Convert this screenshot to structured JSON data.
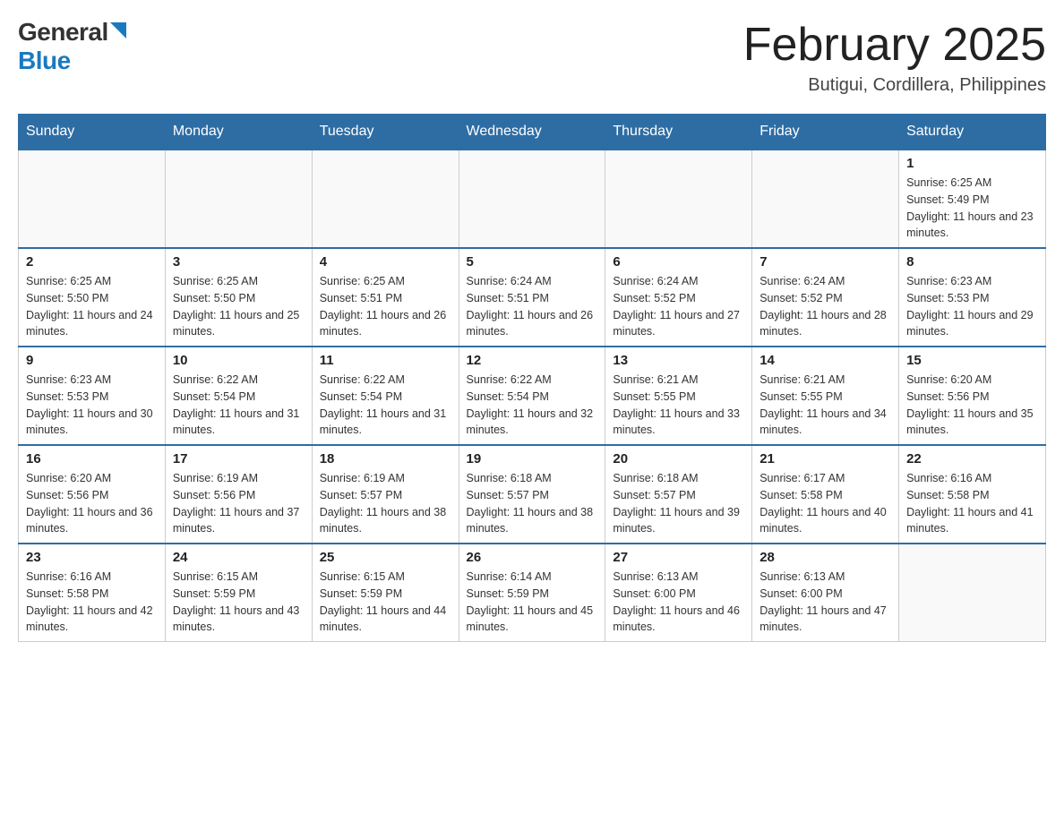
{
  "header": {
    "logo": {
      "general_text": "General",
      "blue_text": "Blue"
    },
    "title": "February 2025",
    "location": "Butigui, Cordillera, Philippines"
  },
  "calendar": {
    "days_of_week": [
      "Sunday",
      "Monday",
      "Tuesday",
      "Wednesday",
      "Thursday",
      "Friday",
      "Saturday"
    ],
    "weeks": [
      [
        {
          "day": "",
          "info": ""
        },
        {
          "day": "",
          "info": ""
        },
        {
          "day": "",
          "info": ""
        },
        {
          "day": "",
          "info": ""
        },
        {
          "day": "",
          "info": ""
        },
        {
          "day": "",
          "info": ""
        },
        {
          "day": "1",
          "info": "Sunrise: 6:25 AM\nSunset: 5:49 PM\nDaylight: 11 hours and 23 minutes."
        }
      ],
      [
        {
          "day": "2",
          "info": "Sunrise: 6:25 AM\nSunset: 5:50 PM\nDaylight: 11 hours and 24 minutes."
        },
        {
          "day": "3",
          "info": "Sunrise: 6:25 AM\nSunset: 5:50 PM\nDaylight: 11 hours and 25 minutes."
        },
        {
          "day": "4",
          "info": "Sunrise: 6:25 AM\nSunset: 5:51 PM\nDaylight: 11 hours and 26 minutes."
        },
        {
          "day": "5",
          "info": "Sunrise: 6:24 AM\nSunset: 5:51 PM\nDaylight: 11 hours and 26 minutes."
        },
        {
          "day": "6",
          "info": "Sunrise: 6:24 AM\nSunset: 5:52 PM\nDaylight: 11 hours and 27 minutes."
        },
        {
          "day": "7",
          "info": "Sunrise: 6:24 AM\nSunset: 5:52 PM\nDaylight: 11 hours and 28 minutes."
        },
        {
          "day": "8",
          "info": "Sunrise: 6:23 AM\nSunset: 5:53 PM\nDaylight: 11 hours and 29 minutes."
        }
      ],
      [
        {
          "day": "9",
          "info": "Sunrise: 6:23 AM\nSunset: 5:53 PM\nDaylight: 11 hours and 30 minutes."
        },
        {
          "day": "10",
          "info": "Sunrise: 6:22 AM\nSunset: 5:54 PM\nDaylight: 11 hours and 31 minutes."
        },
        {
          "day": "11",
          "info": "Sunrise: 6:22 AM\nSunset: 5:54 PM\nDaylight: 11 hours and 31 minutes."
        },
        {
          "day": "12",
          "info": "Sunrise: 6:22 AM\nSunset: 5:54 PM\nDaylight: 11 hours and 32 minutes."
        },
        {
          "day": "13",
          "info": "Sunrise: 6:21 AM\nSunset: 5:55 PM\nDaylight: 11 hours and 33 minutes."
        },
        {
          "day": "14",
          "info": "Sunrise: 6:21 AM\nSunset: 5:55 PM\nDaylight: 11 hours and 34 minutes."
        },
        {
          "day": "15",
          "info": "Sunrise: 6:20 AM\nSunset: 5:56 PM\nDaylight: 11 hours and 35 minutes."
        }
      ],
      [
        {
          "day": "16",
          "info": "Sunrise: 6:20 AM\nSunset: 5:56 PM\nDaylight: 11 hours and 36 minutes."
        },
        {
          "day": "17",
          "info": "Sunrise: 6:19 AM\nSunset: 5:56 PM\nDaylight: 11 hours and 37 minutes."
        },
        {
          "day": "18",
          "info": "Sunrise: 6:19 AM\nSunset: 5:57 PM\nDaylight: 11 hours and 38 minutes."
        },
        {
          "day": "19",
          "info": "Sunrise: 6:18 AM\nSunset: 5:57 PM\nDaylight: 11 hours and 38 minutes."
        },
        {
          "day": "20",
          "info": "Sunrise: 6:18 AM\nSunset: 5:57 PM\nDaylight: 11 hours and 39 minutes."
        },
        {
          "day": "21",
          "info": "Sunrise: 6:17 AM\nSunset: 5:58 PM\nDaylight: 11 hours and 40 minutes."
        },
        {
          "day": "22",
          "info": "Sunrise: 6:16 AM\nSunset: 5:58 PM\nDaylight: 11 hours and 41 minutes."
        }
      ],
      [
        {
          "day": "23",
          "info": "Sunrise: 6:16 AM\nSunset: 5:58 PM\nDaylight: 11 hours and 42 minutes."
        },
        {
          "day": "24",
          "info": "Sunrise: 6:15 AM\nSunset: 5:59 PM\nDaylight: 11 hours and 43 minutes."
        },
        {
          "day": "25",
          "info": "Sunrise: 6:15 AM\nSunset: 5:59 PM\nDaylight: 11 hours and 44 minutes."
        },
        {
          "day": "26",
          "info": "Sunrise: 6:14 AM\nSunset: 5:59 PM\nDaylight: 11 hours and 45 minutes."
        },
        {
          "day": "27",
          "info": "Sunrise: 6:13 AM\nSunset: 6:00 PM\nDaylight: 11 hours and 46 minutes."
        },
        {
          "day": "28",
          "info": "Sunrise: 6:13 AM\nSunset: 6:00 PM\nDaylight: 11 hours and 47 minutes."
        },
        {
          "day": "",
          "info": ""
        }
      ]
    ]
  }
}
